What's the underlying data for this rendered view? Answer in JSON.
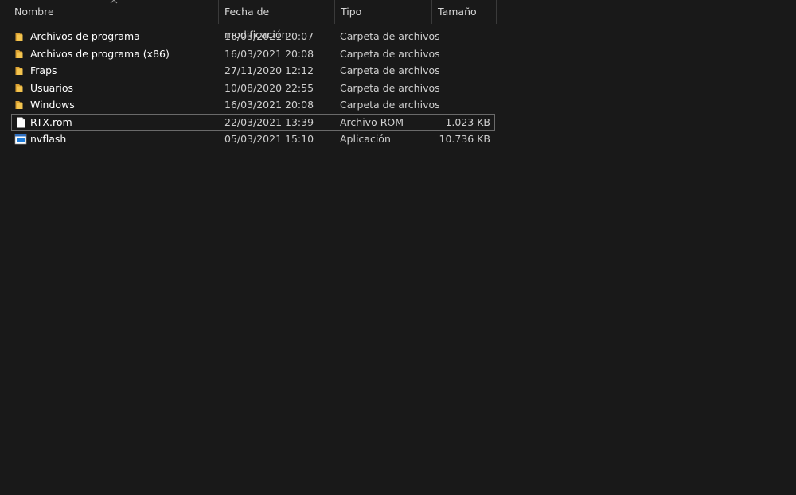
{
  "columns": {
    "name": "Nombre",
    "date": "Fecha de modificación",
    "type": "Tipo",
    "size": "Tamaño"
  },
  "files": [
    {
      "name": "Archivos de programa",
      "date": "16/03/2021 20:07",
      "type": "Carpeta de archivos",
      "size": "",
      "icon": "folder-icon"
    },
    {
      "name": "Archivos de programa (x86)",
      "date": "16/03/2021 20:08",
      "type": "Carpeta de archivos",
      "size": "",
      "icon": "folder-icon"
    },
    {
      "name": "Fraps",
      "date": "27/11/2020 12:12",
      "type": "Carpeta de archivos",
      "size": "",
      "icon": "folder-icon"
    },
    {
      "name": "Usuarios",
      "date": "10/08/2020 22:55",
      "type": "Carpeta de archivos",
      "size": "",
      "icon": "folder-icon"
    },
    {
      "name": "Windows",
      "date": "16/03/2021 20:08",
      "type": "Carpeta de archivos",
      "size": "",
      "icon": "folder-icon"
    },
    {
      "name": "RTX.rom",
      "date": "22/03/2021 13:39",
      "type": "Archivo ROM",
      "size": "1.023 KB",
      "icon": "file-icon"
    },
    {
      "name": "nvflash",
      "date": "05/03/2021 15:10",
      "type": "Aplicación",
      "size": "10.736 KB",
      "icon": "application-icon"
    }
  ],
  "colors": {
    "background": "#191919",
    "folder": "#f3c44f",
    "focus_outline": "#6a6a6a"
  }
}
